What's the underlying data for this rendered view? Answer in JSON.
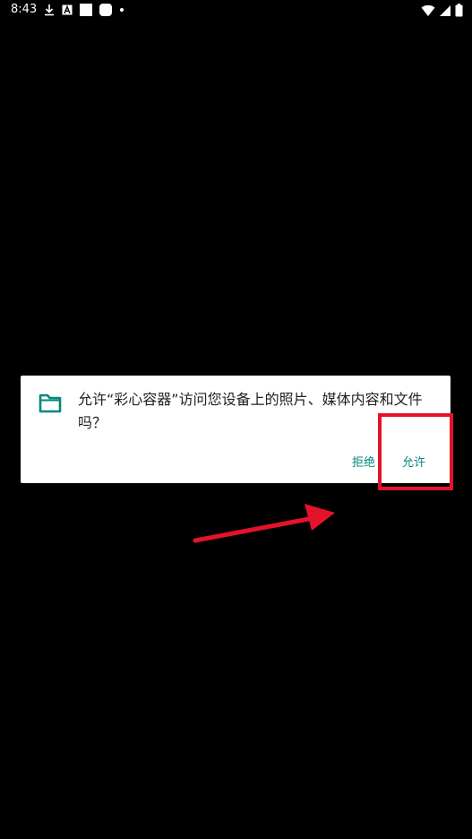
{
  "status_bar": {
    "time": "8:43",
    "left_icons": [
      "download-icon",
      "font-a-icon",
      "square-icon",
      "rounded-square-icon",
      "dot-icon"
    ],
    "right_icons": [
      "wifi-icon",
      "signal-icon",
      "battery-icon"
    ]
  },
  "dialog": {
    "icon": "folder-icon",
    "message": "允许“彩心容器”访问您设备上的照片、媒体内容和文件吗？",
    "deny_label": "拒绝",
    "allow_label": "允许"
  },
  "annotation": {
    "box_color": "#e4122b",
    "arrow_color": "#e4122b"
  }
}
